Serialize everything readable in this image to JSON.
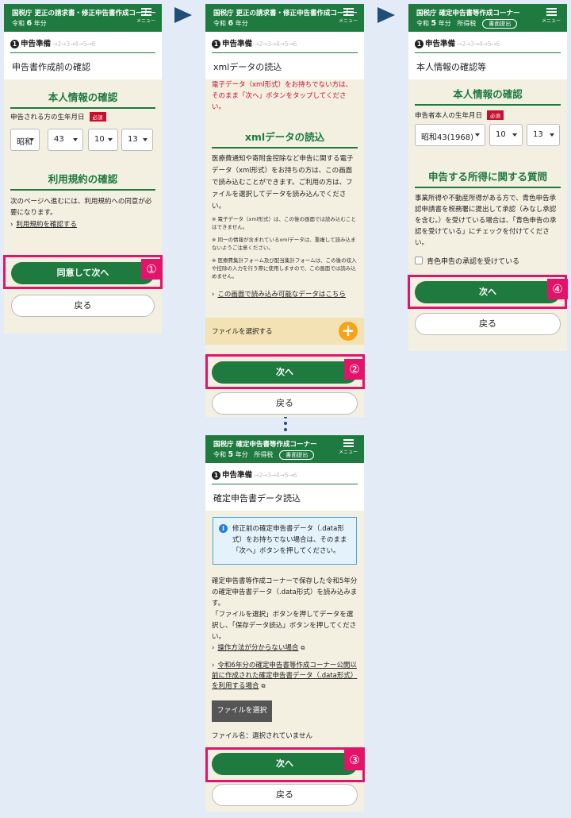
{
  "screen1": {
    "header": {
      "agency": "国税庁",
      "title": "更正の請求書・修正申告書作成コーナー",
      "era": "令和",
      "year": "6",
      "year_suffix": "年分",
      "menu": "メニュー"
    },
    "steps": {
      "active_num": "1",
      "active_label": "申告準備",
      "rest": "→2→3→4→5→6"
    },
    "page_title": "申告書作成前の確認",
    "section1": "本人情報の確認",
    "dob_label": "申告される方の生年月日",
    "required": "必須",
    "dob": {
      "era": "昭和",
      "year": "43",
      "month": "10",
      "day": "13"
    },
    "section2": "利用規約の確認",
    "terms_text": "次のページへ進むには、利用規約への同意が必要になります。",
    "terms_link": "利用規約を確認する",
    "agree_button": "同意して次へ",
    "back_button": "戻る",
    "badge": "①"
  },
  "screen2": {
    "header": {
      "agency": "国税庁",
      "title": "更正の請求書・修正申告書作成コーナー",
      "era": "令和",
      "year": "6",
      "year_suffix": "年分",
      "menu": "メニュー"
    },
    "steps": {
      "active_num": "1",
      "active_label": "申告準備",
      "rest": "→2→3→4→5→6"
    },
    "page_title": "xmlデータの読込",
    "warning": "電子データ（xml形式）をお持ちでない方は、そのまま「次へ」ボタンをタップしてください。",
    "section": "xmlデータの読込",
    "body": "医療費通知や寄附金控除など申告に関する電子データ（xml形式）をお持ちの方は、この画面で読み込むことができます。ご利用の方は、ファイルを選択してデータを読み込んでください。",
    "notes": [
      "※ 電子データ（xml形式）は、この後の画面では読み込むことはできません。",
      "※ 同一の情報が含まれているxmlデータは、重複して読み込まないようご注意ください。",
      "※ 医療費集計フォーム及び配当集計フォームは、この後の収入や控除の入力を行う際に使用しますので、この画面では読み込めません。"
    ],
    "link": "この画面で読み込み可能なデータはこちら",
    "file_select": "ファイルを選択する",
    "next_button": "次へ",
    "back_button": "戻る",
    "badge": "②"
  },
  "screen3": {
    "header": {
      "agency": "国税庁",
      "title": "確定申告書等作成コーナー",
      "era": "令和",
      "year": "5",
      "year_suffix": "年分",
      "tax_type": "所得税",
      "submit_tag": "書面提出",
      "menu": "メニュー"
    },
    "steps": {
      "active_num": "1",
      "active_label": "申告準備",
      "rest": "→2→3→4→5→6"
    },
    "page_title": "確定申告書データ読込",
    "info": "修正前の確定申告書データ（.data形式）をお持ちでない場合は、そのまま「次へ」ボタンを押してください。",
    "body1": "確定申告書等作成コーナーで保存した令和5年分の確定申告書データ（.data形式）を読み込みます。",
    "body2": "「ファイルを選択」ボタンを押してデータを選択し、「保存データ読込」ボタンを押してください。",
    "link1": "操作方法が分からない場合",
    "link2": "令和6年分の確定申告書等作成コーナー公開以前に作成された確定申告書データ（.data形式）を利用する場合",
    "file_button": "ファイルを選択",
    "file_name_label": "ファイル名：選択されていません",
    "next_button": "次へ",
    "back_button": "戻る",
    "badge": "③"
  },
  "screen4": {
    "header": {
      "agency": "国税庁",
      "title": "確定申告書等作成コーナー",
      "era": "令和",
      "year": "5",
      "year_suffix": "年分",
      "tax_type": "所得税",
      "submit_tag": "書面提出",
      "menu": "メニュー"
    },
    "steps": {
      "active_num": "1",
      "active_label": "申告準備",
      "rest": "→2→3→4→5→6"
    },
    "page_title": "本人情報の確認等",
    "section1": "本人情報の確認",
    "dob_label": "申告者本人の生年月日",
    "required": "必須",
    "dob": {
      "year": "昭和43(1968)",
      "month": "10",
      "day": "13"
    },
    "section2": "申告する所得に関する質問",
    "question": "事業所得や不動産所得がある方で、青色申告承認申請書を税務署に提出して承認（みなし承認を含む。）を受けている場合は、「青色申告の承認を受けている」にチェックを付けてください。",
    "checkbox": "青色申告の承認を受けている",
    "next_button": "次へ",
    "back_button": "戻る",
    "badge": "④"
  },
  "colors": {
    "green": "#1e7a3f",
    "highlight": "#e3136b",
    "warning": "#c8102e",
    "arrow": "#1f4e79",
    "file_plus": "#f7a21b"
  }
}
